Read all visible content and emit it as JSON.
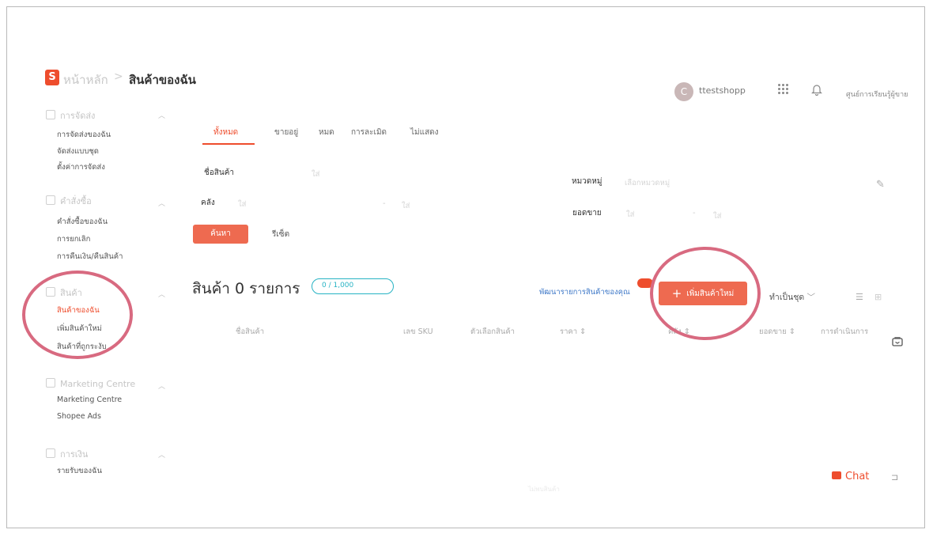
{
  "header": {
    "logo_letter": "S",
    "breadcrumb_home": "หน้าหลัก",
    "breadcrumb_sep": ">",
    "breadcrumb_current": "สินค้าของฉัน",
    "avatar_initial": "C",
    "username": "ttestshopp",
    "help_link": "ศูนย์การเรียนรู้ผู้ขาย"
  },
  "sidebar": {
    "sections": [
      {
        "label": "การจัดส่ง",
        "items": [
          "การจัดส่งของฉัน",
          "จัดส่งแบบชุด",
          "ตั้งค่าการจัดส่ง"
        ]
      },
      {
        "label": "คำสั่งซื้อ",
        "items": [
          "คำสั่งซื้อของฉัน",
          "การยกเลิก",
          "การคืนเงิน/คืนสินค้า"
        ]
      },
      {
        "label": "สินค้า",
        "items": [
          "สินค้าของฉัน",
          "เพิ่มสินค้าใหม่",
          "สินค้าที่ถูกระงับ"
        ]
      },
      {
        "label": "Marketing Centre",
        "items": [
          "Marketing Centre",
          "Shopee Ads"
        ]
      },
      {
        "label": "การเงิน",
        "items": [
          "รายรับของฉัน"
        ]
      }
    ]
  },
  "tabs": [
    "ทั้งหมด",
    "ขายอยู่",
    "หมด",
    "การละเมิด",
    "ไม่แสดง"
  ],
  "filters": {
    "product_name_label": "ชื่อสินค้า",
    "product_name_placeholder": "ใส่",
    "category_label": "หมวดหมู่",
    "category_placeholder": "เลือกหมวดหมู่",
    "stock_label": "คลัง",
    "stock_min": "ใส่",
    "stock_max": "ใส่",
    "sales_label": "ยอดขาย",
    "sales_min": "ใส่",
    "sales_max": "ใส่",
    "range_dash": "-",
    "search_button": "ค้นหา",
    "reset_button": "รีเซ็ต"
  },
  "products": {
    "title": "สินค้า 0 รายการ",
    "quota_badge": "0 / 1,000",
    "improve_link": "พัฒนารายการสินค้าของคุณ",
    "add_button": "เพิ่มสินค้าใหม่",
    "batch_button": "ทำเป็นชุด",
    "columns": [
      "ชื่อสินค้า",
      "เลข SKU",
      "ตัวเลือกสินค้า",
      "ราคา",
      "คลัง",
      "ยอดขาย",
      "การดำเนินการ"
    ]
  },
  "chat": {
    "label": "Chat"
  },
  "footer_text": "ไม่พบสินค้า",
  "colors": {
    "accent": "#ee4d2d",
    "badge": "#27b3c4",
    "annotation": "#d86a80"
  }
}
